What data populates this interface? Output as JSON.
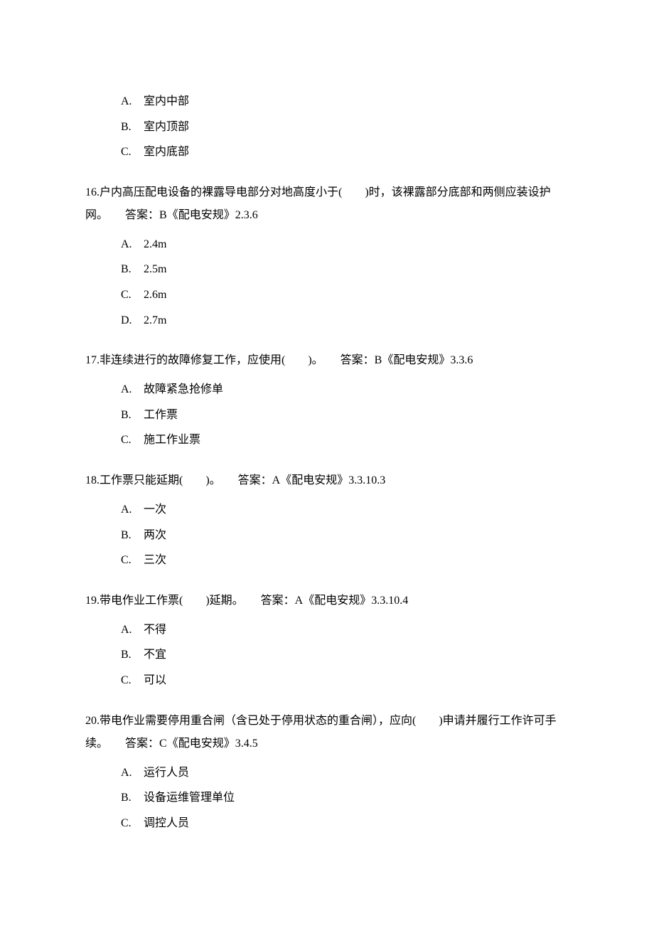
{
  "topOptions": {
    "items": [
      {
        "letter": "A.",
        "text": "室内中部"
      },
      {
        "letter": "B.",
        "text": "室内顶部"
      },
      {
        "letter": "C.",
        "text": "室内底部"
      }
    ]
  },
  "questions": [
    {
      "num": "16.",
      "stem": "户内高压配电设备的裸露导电部分对地高度小于(　　)时，该裸露部分底部和两侧应装设护网。",
      "answer": "答案：B《配电安规》2.3.6",
      "options": [
        {
          "letter": "A.",
          "text": "2.4m"
        },
        {
          "letter": "B.",
          "text": "2.5m"
        },
        {
          "letter": "C.",
          "text": "2.6m"
        },
        {
          "letter": "D.",
          "text": "2.7m"
        }
      ]
    },
    {
      "num": "17.",
      "stem": "非连续进行的故障修复工作，应使用(　　)。",
      "answer": "答案：B《配电安规》3.3.6",
      "options": [
        {
          "letter": "A.",
          "text": "故障紧急抢修单"
        },
        {
          "letter": "B.",
          "text": "工作票"
        },
        {
          "letter": "C.",
          "text": "施工作业票"
        }
      ]
    },
    {
      "num": "18.",
      "stem": "工作票只能延期(　　)。",
      "answer": "答案：A《配电安规》3.3.10.3",
      "options": [
        {
          "letter": "A.",
          "text": "一次"
        },
        {
          "letter": "B.",
          "text": "两次"
        },
        {
          "letter": "C.",
          "text": "三次"
        }
      ]
    },
    {
      "num": "19.",
      "stem": "带电作业工作票(　　)延期。",
      "answer": "答案：A《配电安规》3.3.10.4",
      "options": [
        {
          "letter": "A.",
          "text": "不得"
        },
        {
          "letter": "B.",
          "text": "不宜"
        },
        {
          "letter": "C.",
          "text": "可以"
        }
      ]
    },
    {
      "num": "20.",
      "stem": "带电作业需要停用重合闸（含已处于停用状态的重合闸），应向(　　)申请并履行工作许可手续。",
      "answer": "答案：C《配电安规》3.4.5",
      "options": [
        {
          "letter": "A.",
          "text": "运行人员"
        },
        {
          "letter": "B.",
          "text": "设备运维管理单位"
        },
        {
          "letter": "C.",
          "text": "调控人员"
        }
      ]
    }
  ]
}
